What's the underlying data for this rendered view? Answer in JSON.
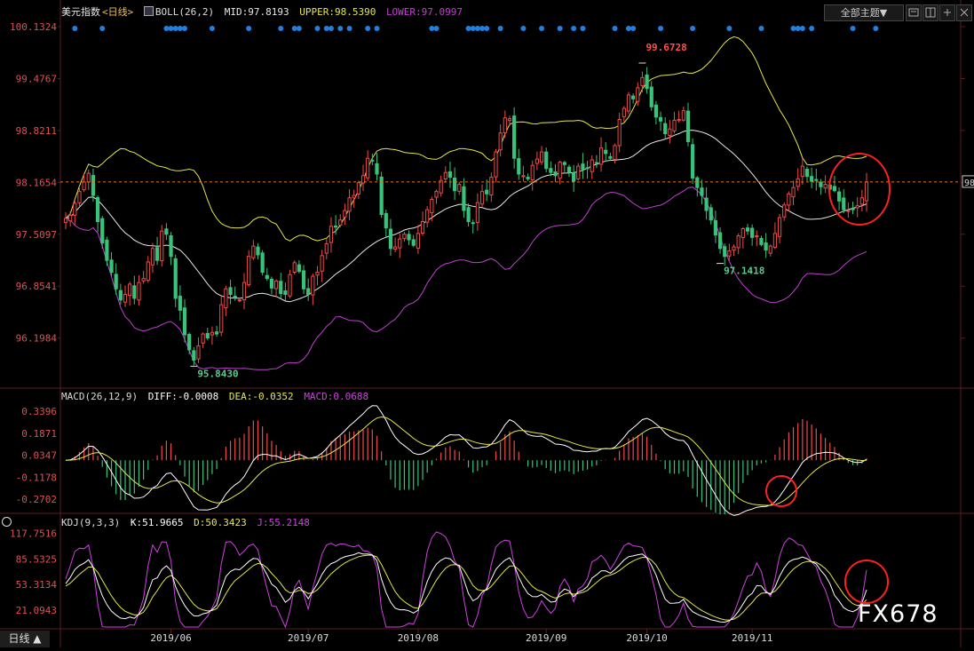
{
  "header": {
    "symbol": "美元指数",
    "period": "<日线>",
    "boll_label": "BOLL(26,2)",
    "mid": "MID:97.8193",
    "upper": "UPPER:98.5390",
    "lower": "LOWER:97.0997",
    "theme_button": "全部主题▼"
  },
  "macd_header": {
    "label": "MACD(26,12,9)",
    "diff": "DIFF:-0.0008",
    "dea": "DEA:-0.0352",
    "macd": "MACD:0.0688"
  },
  "kdj_header": {
    "label": "KDJ(9,3,3)",
    "k": "K:51.9665",
    "d": "D:50.3423",
    "j": "J:55.2148"
  },
  "period_button": "日线 ▲",
  "watermark": "FX678",
  "colors": {
    "up": "#f04a4a",
    "down": "#38c37b",
    "mid": "#e8e8e8",
    "upper": "#e6e648",
    "lower": "#c040d0",
    "diff": "#ffffff",
    "dea": "#e6e648",
    "k": "#ffffff",
    "d": "#e6e648",
    "j": "#d040e0",
    "axis_text": "#e05050",
    "highlight_circle": "#ff2020",
    "signal_dot": "#2080e0"
  },
  "chart_data": [
    {
      "type": "candlestick",
      "title": "美元指数 <日线>",
      "indicator": "BOLL(26,2)",
      "x_ticks": [
        "2019/06",
        "2019/07",
        "2019/08",
        "2019/09",
        "2019/10",
        "2019/11"
      ],
      "y_ticks": [
        "100.1324",
        "99.4767",
        "98.8211",
        "98.1654",
        "97.5097",
        "96.8541",
        "96.1984"
      ],
      "ylim": [
        95.6,
        100.2
      ],
      "last_price": 98.17,
      "annotations": [
        {
          "label": "99.6728",
          "type": "high"
        },
        {
          "label": "97.1418",
          "type": "low"
        },
        {
          "label": "95.8430",
          "type": "low"
        }
      ],
      "right_axis_tag": "98",
      "signal_dot_rows": 1
    },
    {
      "type": "macd",
      "title": "MACD(26,12,9)",
      "y_ticks": [
        "0.3396",
        "0.1871",
        "0.0347",
        "-0.1178",
        "-0.2702"
      ],
      "ylim": [
        -0.35,
        0.39
      ],
      "series_names": [
        "DIFF",
        "DEA",
        "MACD"
      ],
      "last": {
        "DIFF": -0.0008,
        "DEA": -0.0352,
        "MACD": 0.0688
      }
    },
    {
      "type": "kdj",
      "title": "KDJ(9,3,3)",
      "y_ticks": [
        "117.7516",
        "85.5325",
        "53.3134",
        "21.0943"
      ],
      "ylim": [
        0,
        125
      ],
      "series_names": [
        "K",
        "D",
        "J"
      ],
      "last": {
        "K": 51.9665,
        "D": 50.3423,
        "J": 55.2148
      }
    }
  ],
  "series_values": {
    "close": [
      97.71,
      97.75,
      97.9,
      98.05,
      98.17,
      98.28,
      98.0,
      97.67,
      97.4,
      97.18,
      97.03,
      96.82,
      96.68,
      96.75,
      96.88,
      96.7,
      96.9,
      96.95,
      97.16,
      97.33,
      97.18,
      97.55,
      97.51,
      97.23,
      96.7,
      96.55,
      96.24,
      96.05,
      95.92,
      96.1,
      96.25,
      96.2,
      96.27,
      96.25,
      96.62,
      96.82,
      96.75,
      96.71,
      96.68,
      96.9,
      97.23,
      97.36,
      97.25,
      97.03,
      96.95,
      96.83,
      96.92,
      96.76,
      96.75,
      97.0,
      97.15,
      97.04,
      96.82,
      96.75,
      96.98,
      97.03,
      97.24,
      97.39,
      97.61,
      97.6,
      97.69,
      97.81,
      97.97,
      98.0,
      98.16,
      98.25,
      98.47,
      98.44,
      98.27,
      97.76,
      97.59,
      97.33,
      97.35,
      97.45,
      97.51,
      97.44,
      97.37,
      97.52,
      97.67,
      97.82,
      97.95,
      98.05,
      98.19,
      98.29,
      98.23,
      98.06,
      98.14,
      97.81,
      97.67,
      97.65,
      97.91,
      98.05,
      98.02,
      98.23,
      98.55,
      98.79,
      98.98,
      98.97,
      98.47,
      98.27,
      98.25,
      98.21,
      98.38,
      98.46,
      98.55,
      98.34,
      98.29,
      98.25,
      98.42,
      98.39,
      98.29,
      98.18,
      98.37,
      98.33,
      98.34,
      98.45,
      98.41,
      98.6,
      98.53,
      98.47,
      98.63,
      98.96,
      99.1,
      99.27,
      99.22,
      99.36,
      99.49,
      99.35,
      99.12,
      98.99,
      98.94,
      98.78,
      98.84,
      98.95,
      98.96,
      99.07,
      98.68,
      98.22,
      98.1,
      98.0,
      97.81,
      97.69,
      97.5,
      97.33,
      97.23,
      97.3,
      97.35,
      97.49,
      97.58,
      97.55,
      97.47,
      97.49,
      97.38,
      97.31,
      97.36,
      97.52,
      97.72,
      97.88,
      98.02,
      98.1,
      98.21,
      98.37,
      98.24,
      98.18,
      98.19,
      98.11,
      98.14,
      98.08,
      98.06,
      97.93,
      97.82,
      97.81,
      97.82,
      97.87,
      97.97,
      98.17
    ]
  }
}
